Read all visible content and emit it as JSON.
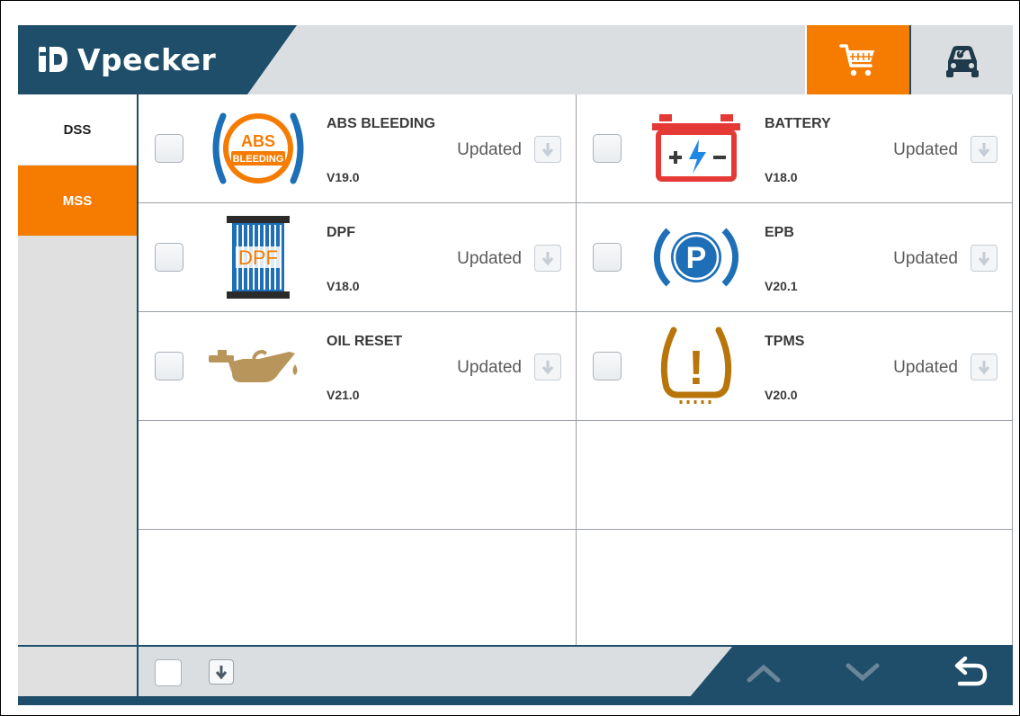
{
  "header": {
    "logo_text": "Vpecker",
    "cart_icon": "cart-icon",
    "car_service_icon": "car-service-icon",
    "colors": {
      "header_dark": "#1f4e6a",
      "accent": "#f57c00",
      "header_light": "#dbdee1"
    }
  },
  "sidebar": {
    "items": [
      {
        "label": "DSS",
        "active": false
      },
      {
        "label": "MSS",
        "active": true
      }
    ]
  },
  "functions": [
    {
      "name": "ABS BLEEDING",
      "version": "V19.0",
      "status": "Updated",
      "icon": "abs-bleeding-icon",
      "icon_text": [
        "ABS",
        "BLEEDING"
      ]
    },
    {
      "name": "BATTERY",
      "version": "V18.0",
      "status": "Updated",
      "icon": "battery-icon"
    },
    {
      "name": "DPF",
      "version": "V18.0",
      "status": "Updated",
      "icon": "dpf-icon",
      "icon_text": [
        "DPF"
      ]
    },
    {
      "name": "EPB",
      "version": "V20.1",
      "status": "Updated",
      "icon": "epb-parking-brake-icon",
      "icon_text": [
        "P"
      ]
    },
    {
      "name": "OIL RESET",
      "version": "V21.0",
      "status": "Updated",
      "icon": "oil-can-icon"
    },
    {
      "name": "TPMS",
      "version": "V20.0",
      "status": "Updated",
      "icon": "tpms-warning-icon",
      "icon_text": [
        "!"
      ]
    }
  ],
  "footer": {
    "select_all_icon": "checkbox-icon",
    "download_icon": "download-icon",
    "up_icon": "chevron-up-icon",
    "down_icon": "chevron-down-icon",
    "back_icon": "back-icon"
  }
}
